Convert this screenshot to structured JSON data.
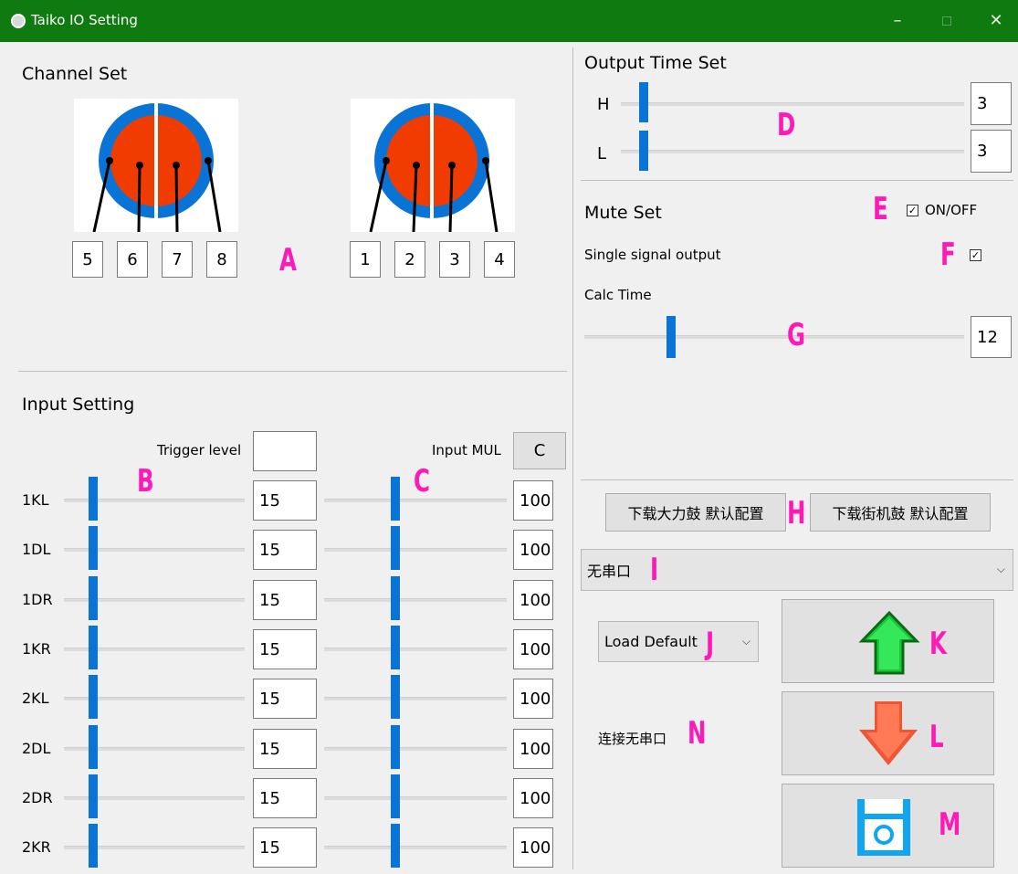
{
  "window": {
    "title": "Taiko IO Setting",
    "controls": {
      "minimize": "–",
      "close": "✕"
    }
  },
  "channel_set": {
    "heading": "Channel Set",
    "left_channels": [
      "5",
      "6",
      "7",
      "8"
    ],
    "right_channels": [
      "1",
      "2",
      "3",
      "4"
    ],
    "colors": {
      "rim": "#0a74d6",
      "face": "#f03c00"
    }
  },
  "input_setting": {
    "heading": "Input Setting",
    "trigger_label": "Trigger level",
    "trigger_value": "",
    "input_mul_label": "Input MUL",
    "input_mul_button": "C",
    "rows": [
      {
        "label": "1KL",
        "trigger": "15",
        "mul": "100"
      },
      {
        "label": "1DL",
        "trigger": "15",
        "mul": "100"
      },
      {
        "label": "1DR",
        "trigger": "15",
        "mul": "100"
      },
      {
        "label": "1KR",
        "trigger": "15",
        "mul": "100"
      },
      {
        "label": "2KL",
        "trigger": "15",
        "mul": "100"
      },
      {
        "label": "2DL",
        "trigger": "15",
        "mul": "100"
      },
      {
        "label": "2DR",
        "trigger": "15",
        "mul": "100"
      },
      {
        "label": "2KR",
        "trigger": "15",
        "mul": "100"
      }
    ]
  },
  "output_time": {
    "heading": "Output Time Set",
    "h_label": "H",
    "h_value": "3",
    "l_label": "L",
    "l_value": "3"
  },
  "mute_set": {
    "heading": "Mute Set",
    "toggle_label": "ON/OFF",
    "single_signal_label": "Single signal output",
    "calc_time_label": "Calc Time",
    "calc_time_value": "12"
  },
  "preset_buttons": {
    "strong_drum": "下载大力鼓 默认配置",
    "arcade_drum": "下载街机鼓 默认配置"
  },
  "port_select": {
    "value": "无串口"
  },
  "load_default": {
    "value": "Load Default"
  },
  "connection_status": "连接无串口",
  "action_icons": {
    "upload": "arrow-up-icon",
    "download": "arrow-down-icon",
    "save": "floppy-disk-icon"
  },
  "markers": {
    "A": "A",
    "B": "B",
    "C": "C",
    "D": "D",
    "E": "E",
    "F": "F",
    "G": "G",
    "H": "H",
    "I": "I",
    "J": "J",
    "K": "K",
    "L": "L",
    "M": "M",
    "N": "N"
  },
  "colors": {
    "titlebar": "#0f7a10",
    "accent": "#0a74d6",
    "marker": "#ff1ab8"
  }
}
